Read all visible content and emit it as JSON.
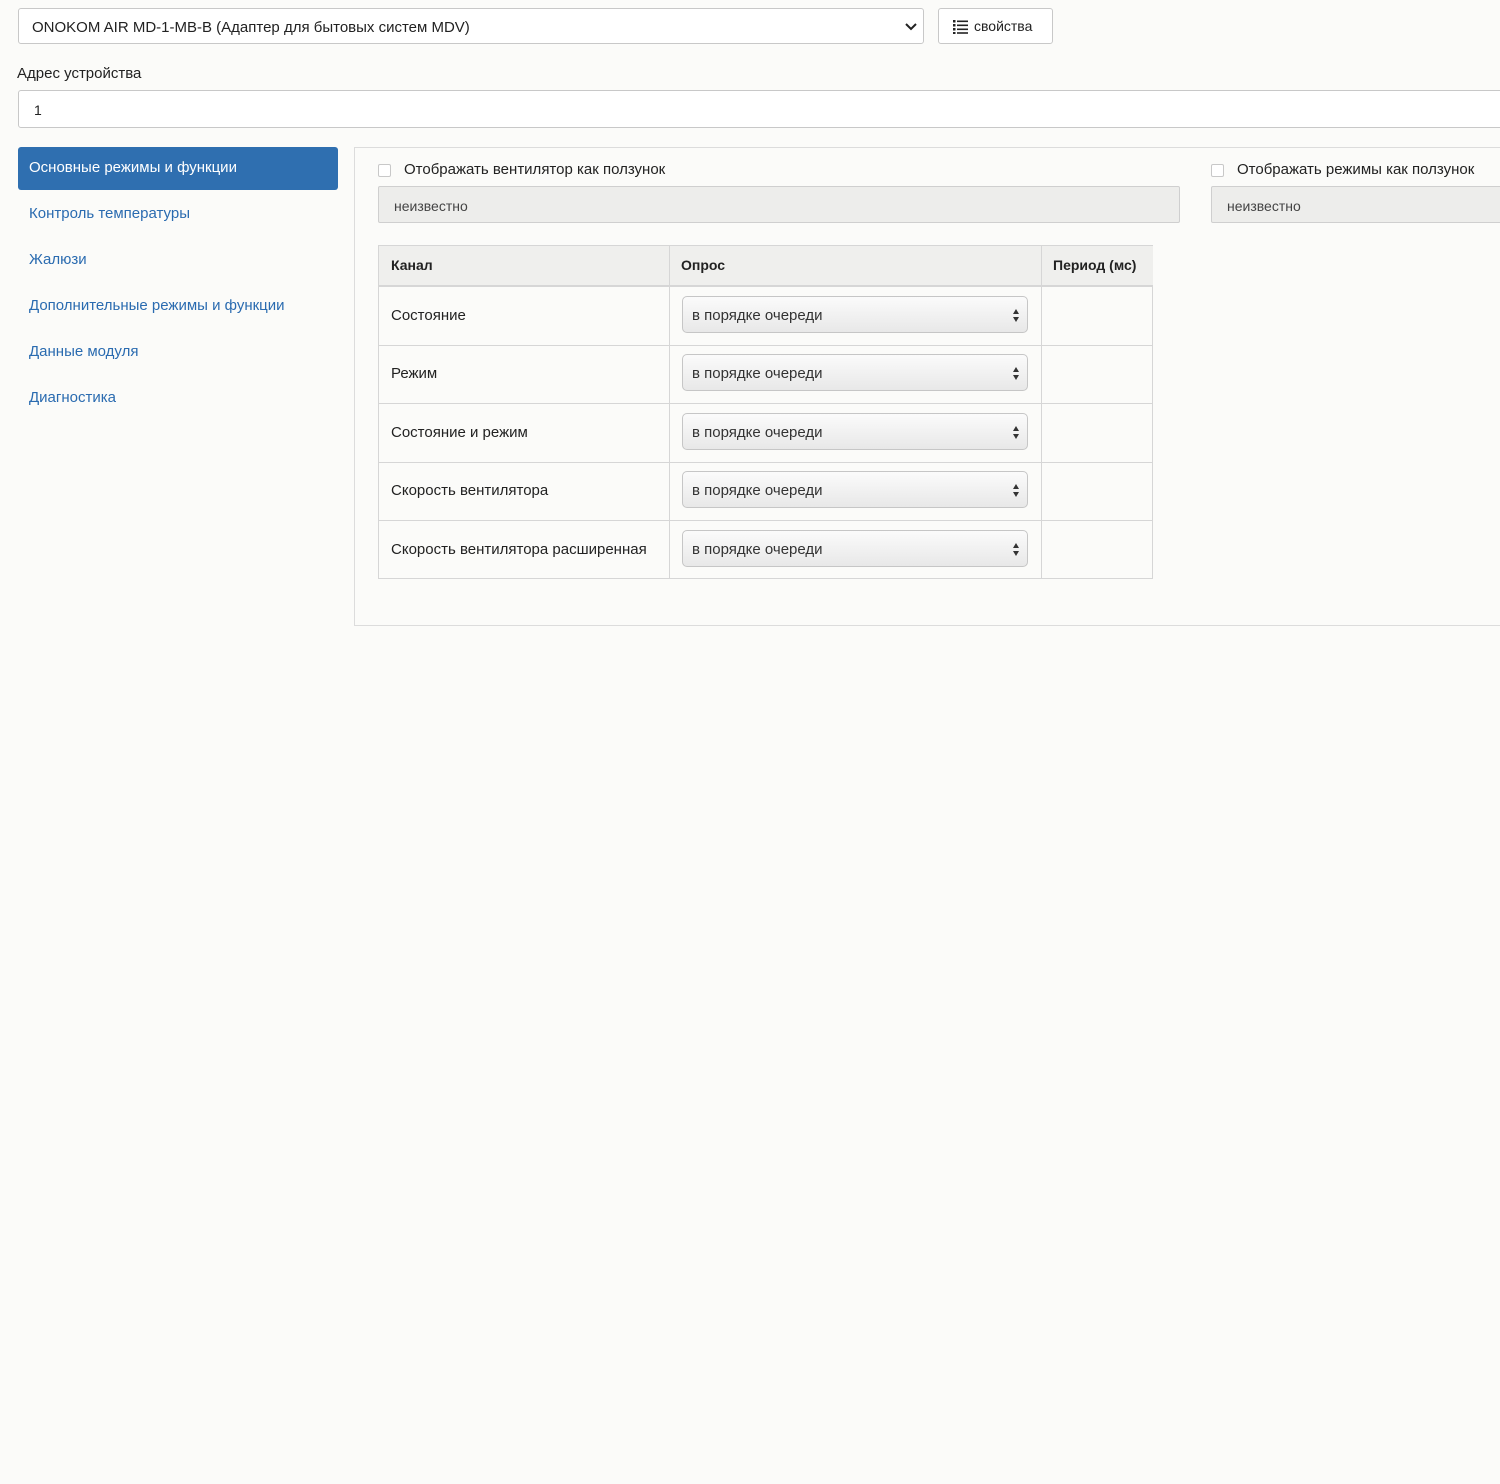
{
  "device_select": {
    "value": "ONOKOM AIR MD-1-MB-B (Адаптер для бытовых систем MDV)"
  },
  "properties_button": {
    "label": "свойства",
    "icon": "list-icon"
  },
  "address": {
    "label": "Адрес устройства",
    "value": "1"
  },
  "sidebar": {
    "items": [
      {
        "label": "Основные режимы и функции",
        "active": true
      },
      {
        "label": "Контроль температуры",
        "active": false
      },
      {
        "label": "Жалюзи",
        "active": false
      },
      {
        "label": "Дополнительные режимы и функции",
        "active": false
      },
      {
        "label": "Данные модуля",
        "active": false
      },
      {
        "label": "Диагностика",
        "active": false
      }
    ]
  },
  "panel": {
    "fan_slider_checkbox": {
      "label": "Отображать вентилятор как ползунок",
      "checked": false
    },
    "fan_value": "неизвестно",
    "modes_slider_checkbox": {
      "label": "Отображать режимы как ползунок",
      "checked": false
    },
    "modes_value": "неизвестно"
  },
  "table": {
    "headers": [
      "Канал",
      "Опрос",
      "Период (мс)"
    ],
    "rows": [
      {
        "channel": "Состояние",
        "poll": "в порядке очереди",
        "period": ""
      },
      {
        "channel": "Режим",
        "poll": "в порядке очереди",
        "period": ""
      },
      {
        "channel": "Состояние и режим",
        "poll": "в порядке очереди",
        "period": ""
      },
      {
        "channel": "Скорость вентилятора",
        "poll": "в порядке очереди",
        "period": ""
      },
      {
        "channel": "Скорость вентилятора расширенная",
        "poll": "в порядке очереди",
        "period": ""
      }
    ]
  },
  "colors": {
    "accent": "#2f6fb0",
    "link": "#2a6bb0"
  }
}
